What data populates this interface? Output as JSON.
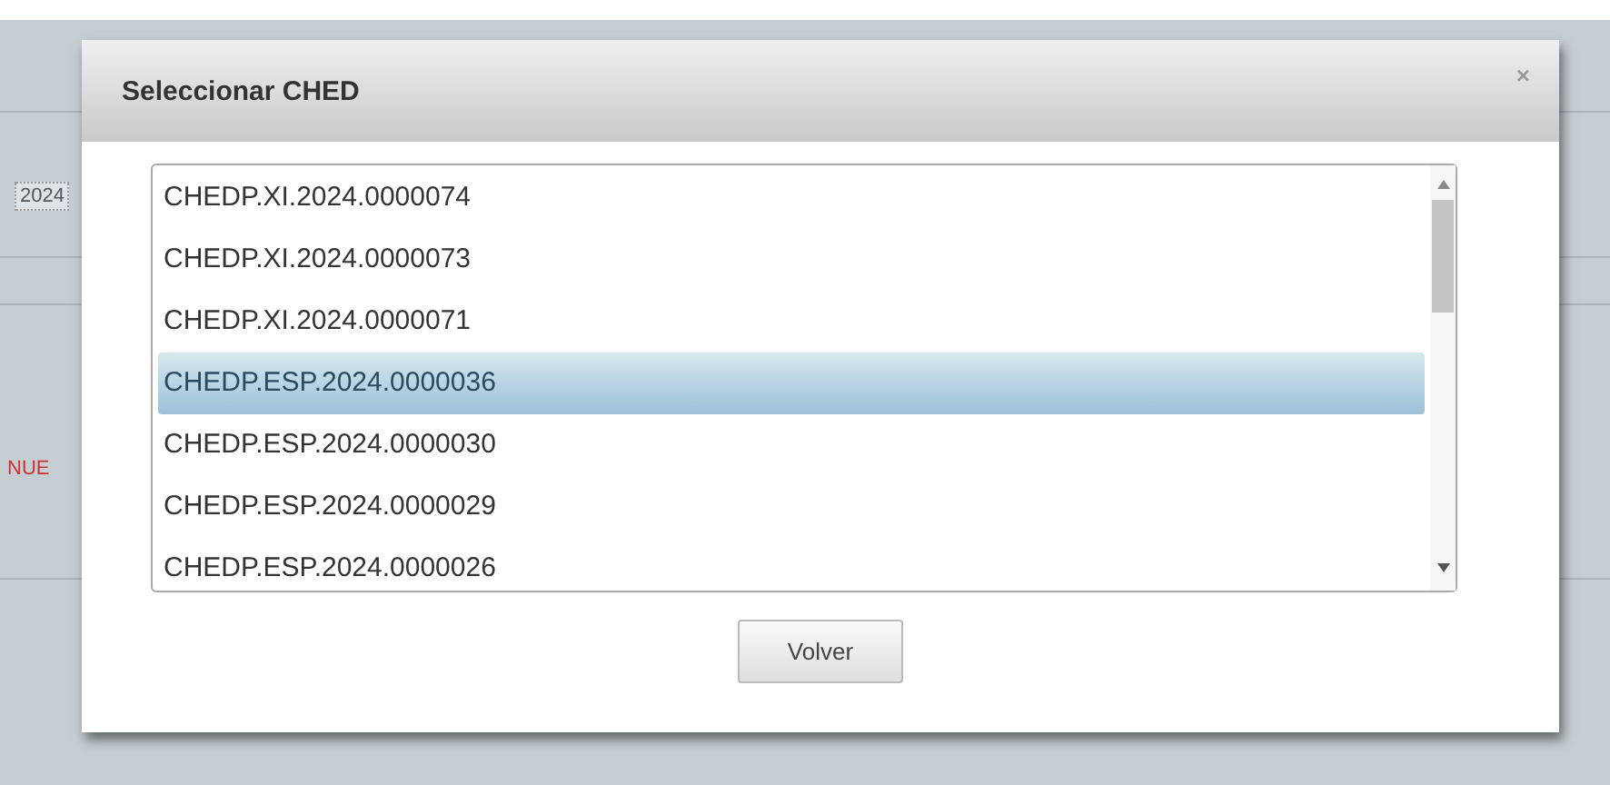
{
  "background": {
    "field_value": "2024",
    "red_text": "NUE"
  },
  "dialog": {
    "title": "Seleccionar CHED",
    "close": "×",
    "options": [
      {
        "label": "CHEDP.XI.2024.0000074",
        "selected": false
      },
      {
        "label": "CHEDP.XI.2024.0000073",
        "selected": false
      },
      {
        "label": "CHEDP.XI.2024.0000071",
        "selected": false
      },
      {
        "label": "CHEDP.ESP.2024.0000036",
        "selected": true
      },
      {
        "label": "CHEDP.ESP.2024.0000030",
        "selected": false
      },
      {
        "label": "CHEDP.ESP.2024.0000029",
        "selected": false
      },
      {
        "label": "CHEDP.ESP.2024.0000026",
        "selected": false
      }
    ],
    "button": "Volver"
  }
}
